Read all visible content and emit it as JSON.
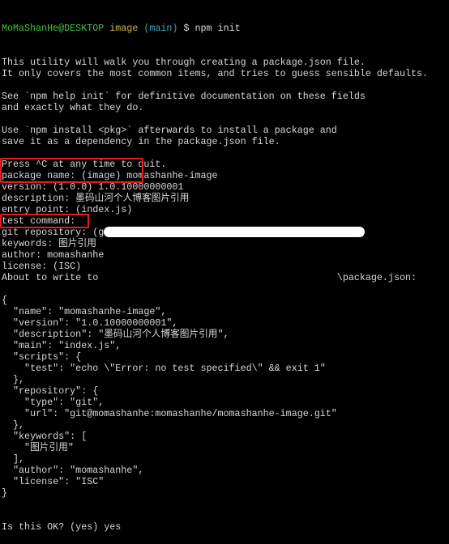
{
  "prompt": {
    "user_host": "MoMaShanHe@DESKTOP",
    "dir": "image",
    "branch": "(main)",
    "symbol": "$",
    "command": "npm init"
  },
  "lines": [
    "This utility will walk you through creating a package.json file.",
    "It only covers the most common items, and tries to guess sensible defaults.",
    "",
    "See `npm help init` for definitive documentation on these fields",
    "and exactly what they do.",
    "",
    "Use `npm install <pkg>` afterwards to install a package and",
    "save it as a dependency in the package.json file.",
    "",
    "Press ^C at any time to quit.",
    "package name: (image) momashanhe-image",
    "version: (1.0.0) 1.0.10000000001",
    "description: 墨码山河个人博客图片引用",
    "entry point: (index.js)",
    "test command:",
    "git repository: (git@momashanhe:momashanhe/momashanhe-image.git)",
    "keywords: 图片引用",
    "author: momashanhe",
    "license: (ISC)",
    "About to write to                                          \\package.json:",
    "",
    "{",
    "  \"name\": \"momashanhe-image\",",
    "  \"version\": \"1.0.10000000001\",",
    "  \"description\": \"墨码山河个人博客图片引用\",",
    "  \"main\": \"index.js\",",
    "  \"scripts\": {",
    "    \"test\": \"echo \\\"Error: no test specified\\\" && exit 1\"",
    "  },",
    "  \"repository\": {",
    "    \"type\": \"git\",",
    "    \"url\": \"git@momashanhe:momashanhe/momashanhe-image.git\"",
    "  },",
    "  \"keywords\": [",
    "    \"图片引用\"",
    "  ],",
    "  \"author\": \"momashanhe\",",
    "  \"license\": \"ISC\"",
    "}",
    "",
    "",
    "Is this OK? (yes) yes"
  ],
  "colors": {
    "highlight_box": "#e0201e",
    "user_host": "#3fc23f",
    "dir": "#c8b94a",
    "branch": "#3aa6b8"
  }
}
